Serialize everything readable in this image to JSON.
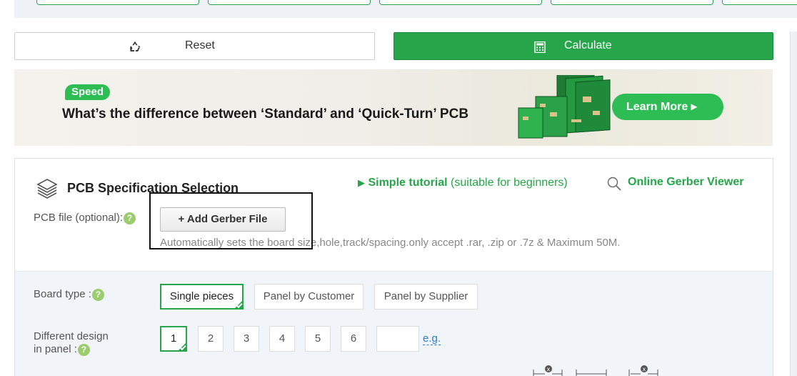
{
  "actions": {
    "reset_label": "Reset",
    "calculate_label": "Calculate"
  },
  "banner": {
    "badge": "Speed",
    "headline": "What’s the difference between ‘Standard’ and ‘Quick-Turn’ PCB",
    "cta": "Learn More ▸"
  },
  "spec": {
    "title": "PCB Specification Selection",
    "tutorial_link": "Simple tutorial",
    "tutorial_note": "(suitable for beginners)",
    "viewer_link": "Online Gerber Viewer",
    "file_label": "PCB file (optional):",
    "add_gerber_label": "+ Add Gerber File",
    "file_hint": "Automatically sets the board size,hole,track/spacing.only accept .rar, .zip or .7z & Maximum 50M."
  },
  "board_type": {
    "label": "Board type :",
    "options": [
      "Single pieces",
      "Panel by Customer",
      "Panel by Supplier"
    ],
    "selected": "Single pieces"
  },
  "design_in_panel": {
    "label_line1": "Different design",
    "label_line2": "in panel :",
    "options": [
      "1",
      "2",
      "3",
      "4",
      "5",
      "6"
    ],
    "selected": "1",
    "custom_value": "",
    "example_link": "e.g."
  },
  "colors": {
    "accent_green": "#27a54a",
    "link_blue": "#2a7ad8"
  }
}
